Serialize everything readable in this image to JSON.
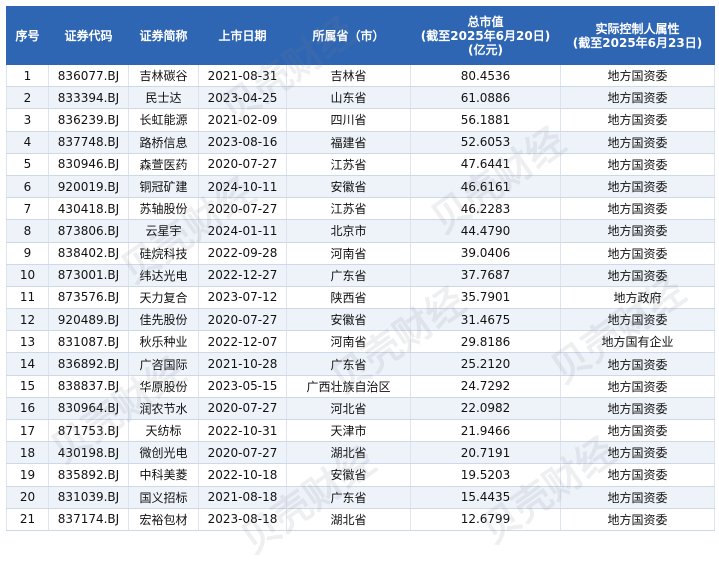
{
  "colors": {
    "header_bg": "#2e66b3",
    "header_text": "#ffffff",
    "row_alt": "#eef3fa"
  },
  "watermark_text": "贝壳财经",
  "headers": {
    "seq": "序号",
    "code": "证券代码",
    "name": "证券简称",
    "date": "上市日期",
    "province": "所属省（市）",
    "cap_line1": "总市值",
    "cap_line2": "(截至2025年6月20日)",
    "cap_line3": "(亿元)",
    "ctrl_line1": "实际控制人属性",
    "ctrl_line2": "(截至2025年6月23日)"
  },
  "rows": [
    {
      "seq": "1",
      "code": "836077.BJ",
      "name": "吉林碳谷",
      "date": "2021-08-31",
      "province": "吉林省",
      "cap": "80.4536",
      "ctrl": "地方国资委"
    },
    {
      "seq": "2",
      "code": "833394.BJ",
      "name": "民士达",
      "date": "2023-04-25",
      "province": "山东省",
      "cap": "61.0886",
      "ctrl": "地方国资委"
    },
    {
      "seq": "3",
      "code": "836239.BJ",
      "name": "长虹能源",
      "date": "2021-02-09",
      "province": "四川省",
      "cap": "56.1881",
      "ctrl": "地方国资委"
    },
    {
      "seq": "4",
      "code": "837748.BJ",
      "name": "路桥信息",
      "date": "2023-08-16",
      "province": "福建省",
      "cap": "52.6053",
      "ctrl": "地方国资委"
    },
    {
      "seq": "5",
      "code": "830946.BJ",
      "name": "森萱医药",
      "date": "2020-07-27",
      "province": "江苏省",
      "cap": "47.6441",
      "ctrl": "地方国资委"
    },
    {
      "seq": "6",
      "code": "920019.BJ",
      "name": "铜冠矿建",
      "date": "2024-10-11",
      "province": "安徽省",
      "cap": "46.6161",
      "ctrl": "地方国资委"
    },
    {
      "seq": "7",
      "code": "430418.BJ",
      "name": "苏轴股份",
      "date": "2020-07-27",
      "province": "江苏省",
      "cap": "46.2283",
      "ctrl": "地方国资委"
    },
    {
      "seq": "8",
      "code": "873806.BJ",
      "name": "云星宇",
      "date": "2024-01-11",
      "province": "北京市",
      "cap": "44.4790",
      "ctrl": "地方国资委"
    },
    {
      "seq": "9",
      "code": "838402.BJ",
      "name": "硅烷科技",
      "date": "2022-09-28",
      "province": "河南省",
      "cap": "39.0406",
      "ctrl": "地方国资委"
    },
    {
      "seq": "10",
      "code": "873001.BJ",
      "name": "纬达光电",
      "date": "2022-12-27",
      "province": "广东省",
      "cap": "37.7687",
      "ctrl": "地方国资委"
    },
    {
      "seq": "11",
      "code": "873576.BJ",
      "name": "天力复合",
      "date": "2023-07-12",
      "province": "陕西省",
      "cap": "35.7901",
      "ctrl": "地方政府"
    },
    {
      "seq": "12",
      "code": "920489.BJ",
      "name": "佳先股份",
      "date": "2020-07-27",
      "province": "安徽省",
      "cap": "31.4675",
      "ctrl": "地方国资委"
    },
    {
      "seq": "13",
      "code": "831087.BJ",
      "name": "秋乐种业",
      "date": "2022-12-07",
      "province": "河南省",
      "cap": "29.8186",
      "ctrl": "地方国有企业"
    },
    {
      "seq": "14",
      "code": "836892.BJ",
      "name": "广咨国际",
      "date": "2021-10-28",
      "province": "广东省",
      "cap": "25.2120",
      "ctrl": "地方国资委"
    },
    {
      "seq": "15",
      "code": "838837.BJ",
      "name": "华原股份",
      "date": "2023-05-15",
      "province": "广西壮族自治区",
      "cap": "24.7292",
      "ctrl": "地方国资委"
    },
    {
      "seq": "16",
      "code": "830964.BJ",
      "name": "润农节水",
      "date": "2020-07-27",
      "province": "河北省",
      "cap": "22.0982",
      "ctrl": "地方国资委"
    },
    {
      "seq": "17",
      "code": "871753.BJ",
      "name": "天纺标",
      "date": "2022-10-31",
      "province": "天津市",
      "cap": "21.9466",
      "ctrl": "地方国资委"
    },
    {
      "seq": "18",
      "code": "430198.BJ",
      "name": "微创光电",
      "date": "2020-07-27",
      "province": "湖北省",
      "cap": "20.7191",
      "ctrl": "地方国资委"
    },
    {
      "seq": "19",
      "code": "835892.BJ",
      "name": "中科美菱",
      "date": "2022-10-18",
      "province": "安徽省",
      "cap": "19.5203",
      "ctrl": "地方国资委"
    },
    {
      "seq": "20",
      "code": "831039.BJ",
      "name": "国义招标",
      "date": "2021-08-18",
      "province": "广东省",
      "cap": "15.4435",
      "ctrl": "地方国资委"
    },
    {
      "seq": "21",
      "code": "837174.BJ",
      "name": "宏裕包材",
      "date": "2023-08-18",
      "province": "湖北省",
      "cap": "12.6799",
      "ctrl": "地方国资委"
    }
  ]
}
